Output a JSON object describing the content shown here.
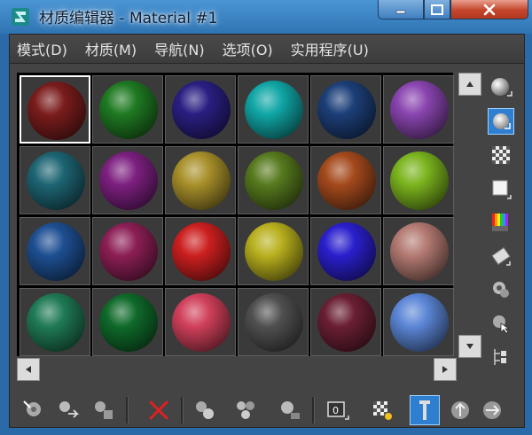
{
  "window": {
    "title": "材质编辑器 - Material #1",
    "controls": {
      "minimize": "minimize",
      "maximize": "maximize",
      "close": "close"
    }
  },
  "menu": {
    "items": [
      {
        "label": "模式(D)"
      },
      {
        "label": "材质(M)"
      },
      {
        "label": "导航(N)"
      },
      {
        "label": "选项(O)"
      },
      {
        "label": "实用程序(U)"
      }
    ]
  },
  "slots": {
    "selected_index": 0,
    "colors": [
      "#7a1c1c",
      "#1f7a22",
      "#2a1f82",
      "#11a6a6",
      "#1c3f78",
      "#8a45b0",
      "#1d6573",
      "#7d2080",
      "#a8902a",
      "#577a1e",
      "#a44a1c",
      "#7bb41e",
      "#1e4f92",
      "#8c1f55",
      "#cc1f1f",
      "#b8b01e",
      "#2a1fcc",
      "#b37a72",
      "#1f7a55",
      "#0f6a2a",
      "#d0405a",
      "#505050",
      "#6a1f33",
      "#5c86d6"
    ]
  },
  "icons": {
    "side": [
      "sample-type-sphere-icon",
      "backlight-icon",
      "background-checker-icon",
      "sample-uv-tiling-icon",
      "video-color-check-icon",
      "make-preview-icon",
      "options-icon",
      "select-by-material-icon",
      "material-map-navigator-icon"
    ],
    "bottom": [
      "get-material-icon",
      "put-to-scene-icon",
      "assign-to-selection-icon",
      "reset-map-icon",
      "make-copy-icon",
      "make-unique-icon",
      "put-to-library-icon",
      "material-id-channel-icon",
      "show-map-in-viewport-icon",
      "show-end-result-icon",
      "go-to-parent-icon",
      "go-forward-to-sibling-icon"
    ]
  },
  "colors": {
    "title_bar": "#2f74b3",
    "panel": "#444444",
    "selection_accent": "#2f7fd0",
    "close_button": "#c4452c"
  }
}
